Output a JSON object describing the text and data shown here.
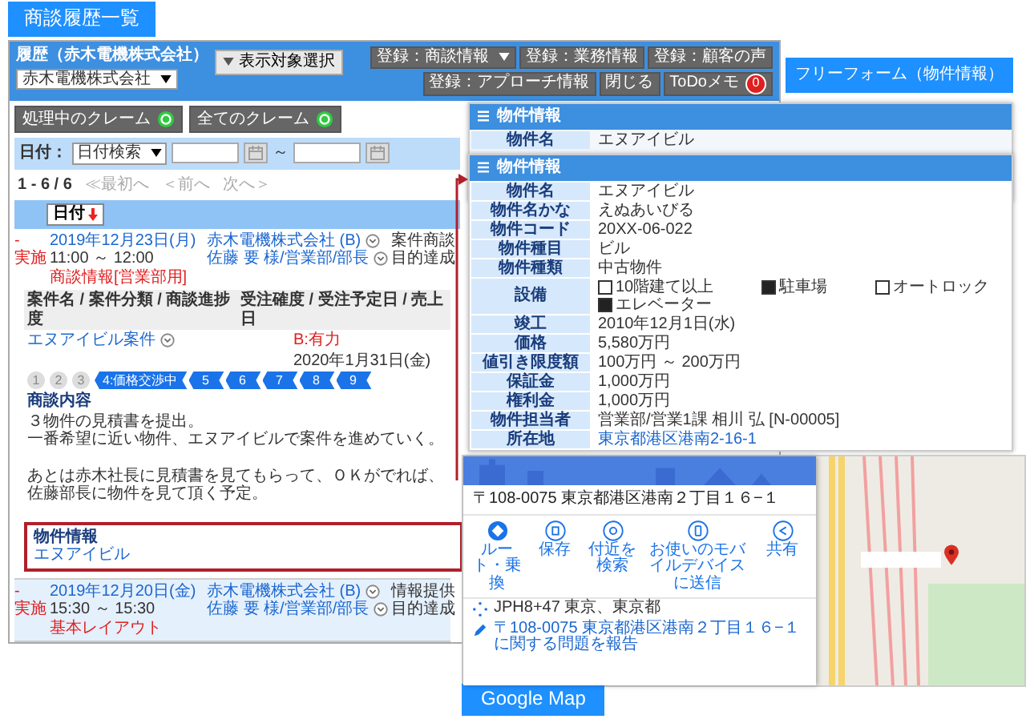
{
  "page_title": "商談履歴一覧",
  "history_window": {
    "title": "履歴（赤木電機株式会社）",
    "company_select": "赤木電機株式会社",
    "display_button": "表示対象選択",
    "register_buttons": [
      {
        "label": "登録：商談情報",
        "has_menu": true
      },
      {
        "label": "登録：業務情報",
        "has_menu": false
      },
      {
        "label": "登録：顧客の声",
        "has_menu": false
      },
      {
        "label": "登録：アプローチ情報",
        "has_menu": false
      }
    ],
    "close_button": "閉じる",
    "todo_button": {
      "label": "ToDoメモ",
      "badge": "0"
    },
    "claim_buttons": [
      "処理中のクレーム",
      "全てのクレーム"
    ],
    "date_filter": {
      "label": "日付：",
      "mode": "日付検索",
      "separator": "～"
    },
    "pager": {
      "range": "1 - 6 / 6",
      "links": [
        {
          "label": "≪最初へ",
          "disabled": true
        },
        {
          "label": "＜前へ",
          "disabled": true
        },
        {
          "label": "次へ＞",
          "disabled": true
        }
      ]
    },
    "sort_column": "日付",
    "records": [
      {
        "status_mark": "-",
        "status": "実施",
        "date": "2019年12月23日(月)",
        "time": "11:00 ～ 12:00",
        "layout": "商談情報[営業部用]",
        "company": "赤木電機株式会社 (B)",
        "contact": "佐藤 要 様/営業部/部長",
        "category": "案件商談",
        "result": "目的達成",
        "details": {
          "project_header": "案件名 / 案件分類 / 商談進捗度",
          "order_header": "受注確度 / 受注予定日 / 売上日",
          "project": "エヌアイビル案件",
          "steps": [
            {
              "label": "1",
              "kind": "past"
            },
            {
              "label": "2",
              "kind": "past"
            },
            {
              "label": "3",
              "kind": "past"
            },
            {
              "label": "4:価格交渉中",
              "kind": "current"
            },
            {
              "label": "5",
              "kind": "future"
            },
            {
              "label": "6",
              "kind": "future"
            },
            {
              "label": "7",
              "kind": "future"
            },
            {
              "label": "8",
              "kind": "future"
            },
            {
              "label": "9",
              "kind": "future"
            }
          ],
          "probability": "B:有力",
          "order_date": "2020年1月31日(金)",
          "memo_title": "商談内容",
          "memo": [
            [
              "３物件の見積書を提出。",
              "一番希望に近い物件、エヌアイビルで案件を進めていく。"
            ],
            [
              "あとは赤木社長に見積書を見てもらって、ＯＫがでれば、",
              "佐藤部長に物件を見て頂く予定。"
            ]
          ],
          "attachment": {
            "title": "物件情報",
            "link": "エヌアイビル"
          }
        }
      },
      {
        "status_mark": "-",
        "status": "実施",
        "date": "2019年12月20日(金)",
        "time": "15:30 ～ 15:30",
        "layout": "基本レイアウト",
        "company": "赤木電機株式会社 (B)",
        "contact": "佐藤 要 様/営業部/部長",
        "category": "情報提供",
        "result": "目的達成"
      }
    ]
  },
  "free_form": {
    "label": "フリーフォーム（物件情報）",
    "back_panel": {
      "title": "物件情報",
      "rows": [
        {
          "label": "物件名",
          "value": "エヌアイビル"
        }
      ]
    },
    "panel": {
      "title": "物件情報",
      "rows": [
        {
          "kind": "text",
          "label": "物件名",
          "value": "エヌアイビル"
        },
        {
          "kind": "text",
          "label": "物件名かな",
          "value": "えぬあいびる"
        },
        {
          "kind": "text",
          "label": "物件コード",
          "value": "20XX-06-022"
        },
        {
          "kind": "text",
          "label": "物件種目",
          "value": "ビル"
        },
        {
          "kind": "text",
          "label": "物件種類",
          "value": "中古物件"
        },
        {
          "kind": "checklist",
          "label": "設備",
          "options": [
            {
              "label": "10階建て以上",
              "checked": false
            },
            {
              "label": "駐車場",
              "checked": true
            },
            {
              "label": "オートロック",
              "checked": false
            },
            {
              "label": "エレベーター",
              "checked": true
            }
          ]
        },
        {
          "kind": "text",
          "label": "竣工",
          "value": "2010年12月1日(水)"
        },
        {
          "kind": "text",
          "label": "価格",
          "value": "5,580万円"
        },
        {
          "kind": "text",
          "label": "値引き限度額",
          "value": "100万円 ～ 200万円"
        },
        {
          "kind": "text",
          "label": "保証金",
          "value": "1,000万円"
        },
        {
          "kind": "text",
          "label": "権利金",
          "value": "1,000万円"
        },
        {
          "kind": "text",
          "label": "物件担当者",
          "value": "営業部/営業1課 相川 弘 [N-00005]"
        },
        {
          "kind": "link",
          "label": "所在地",
          "value": "東京都港区港南2-16-1"
        }
      ]
    }
  },
  "map": {
    "address": "〒108-0075 東京都港区港南２丁目１６−１",
    "actions": [
      {
        "kind": "route",
        "label": "ルート・乗換"
      },
      {
        "kind": "save",
        "label": "保存"
      },
      {
        "kind": "nearby",
        "label": "付近を検索"
      },
      {
        "kind": "send",
        "label": "お使いのモバイルデバイスに送信"
      },
      {
        "kind": "share",
        "label": "共有"
      }
    ],
    "plus_code": "JPH8+47 東京、東京都",
    "report": "〒108-0075 東京都港区港南２丁目１６−１に関する問題を報告",
    "label": "Google Map"
  }
}
